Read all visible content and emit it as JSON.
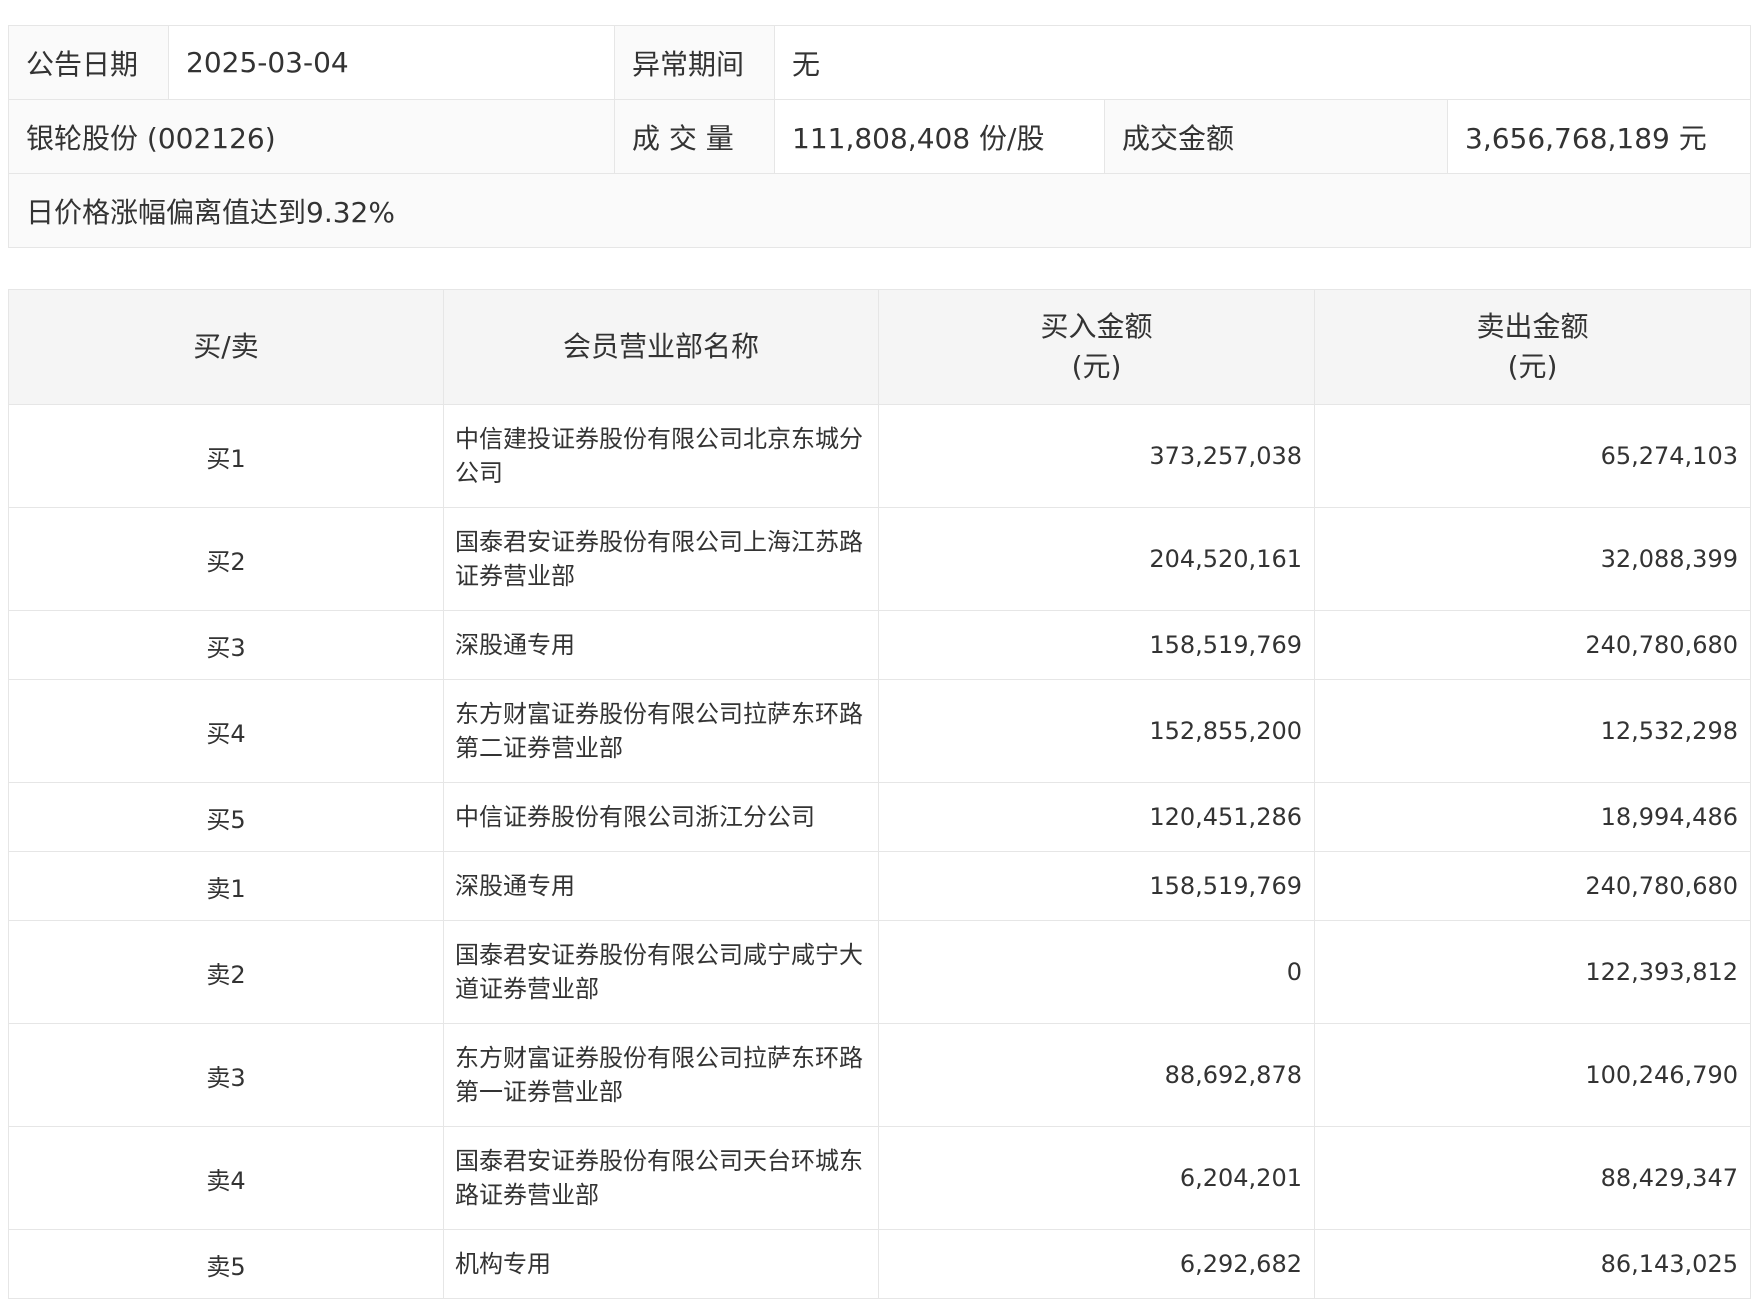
{
  "info": {
    "date_label": "公告日期",
    "date_value": "2025-03-04",
    "period_label": "异常期间",
    "period_value": "无",
    "stock": "银轮股份 (002126)",
    "volume_label": "成 交 量",
    "volume_value": "111,808,408 份/股",
    "amount_label": "成交金额",
    "amount_value": "3,656,768,189 元",
    "remark": "日价格涨幅偏离值达到9.32%"
  },
  "table": {
    "headers": {
      "side": "买/卖",
      "name": "会员营业部名称",
      "buy_line1": "买入金额",
      "buy_line2": "(元)",
      "sell_line1": "卖出金额",
      "sell_line2": "(元)"
    },
    "rows": [
      {
        "side": "买1",
        "name": "中信建投证券股份有限公司北京东城分公司",
        "buy": "373,257,038",
        "sell": "65,274,103"
      },
      {
        "side": "买2",
        "name": "国泰君安证券股份有限公司上海江苏路证券营业部",
        "buy": "204,520,161",
        "sell": "32,088,399"
      },
      {
        "side": "买3",
        "name": "深股通专用",
        "buy": "158,519,769",
        "sell": "240,780,680"
      },
      {
        "side": "买4",
        "name": "东方财富证券股份有限公司拉萨东环路第二证券营业部",
        "buy": "152,855,200",
        "sell": "12,532,298"
      },
      {
        "side": "买5",
        "name": "中信证券股份有限公司浙江分公司",
        "buy": "120,451,286",
        "sell": "18,994,486"
      },
      {
        "side": "卖1",
        "name": "深股通专用",
        "buy": "158,519,769",
        "sell": "240,780,680"
      },
      {
        "side": "卖2",
        "name": "国泰君安证券股份有限公司咸宁咸宁大道证券营业部",
        "buy": "0",
        "sell": "122,393,812"
      },
      {
        "side": "卖3",
        "name": "东方财富证券股份有限公司拉萨东环路第一证券营业部",
        "buy": "88,692,878",
        "sell": "100,246,790"
      },
      {
        "side": "卖4",
        "name": "国泰君安证券股份有限公司天台环城东路证券营业部",
        "buy": "6,204,201",
        "sell": "88,429,347"
      },
      {
        "side": "卖5",
        "name": "机构专用",
        "buy": "6,292,682",
        "sell": "86,143,025"
      }
    ]
  }
}
